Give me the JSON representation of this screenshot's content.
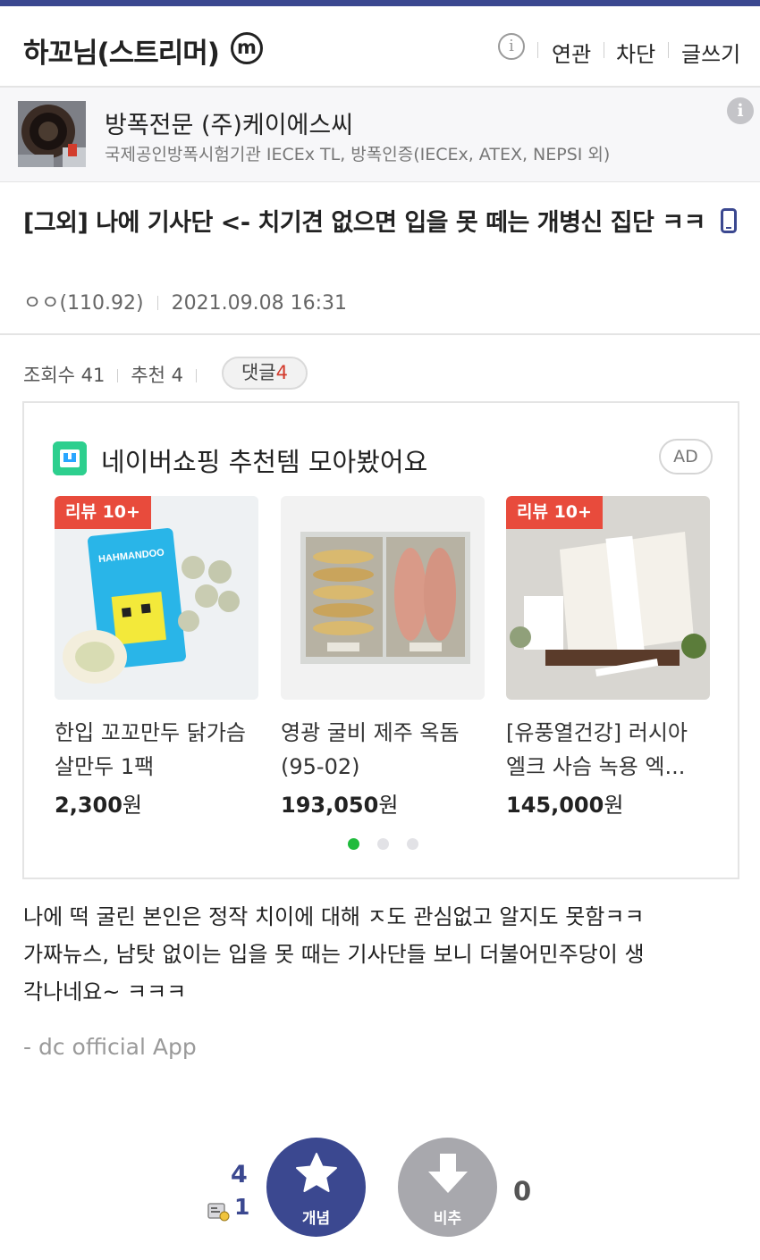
{
  "header": {
    "gallery_title": "하꼬님(스트리머)",
    "minor_badge": "m",
    "info_icon": "info-icon",
    "nav": [
      "연관",
      "차단",
      "글쓰기"
    ]
  },
  "ad_banner": {
    "company": "방폭전문 (주)케이에스씨",
    "description": "국제공인방폭시험기관 IECEx TL, 방폭인증(IECEx, ATEX, NEPSI 외)",
    "info_icon": "info-icon"
  },
  "post": {
    "title": "[그외] 나에 기사단 <- 치기견 없으면 입을 못 떼는 개병신 집단 ㅋㅋ",
    "title_icon": "mobile-phone-icon",
    "author": "ㅇㅇ(110.92)",
    "date": "2021.09.08 16:31",
    "views_label": "조회수 41",
    "recommend_label": "추천 4",
    "comment_label": "댓글",
    "comment_count": "4",
    "body_lines": [
      "나에 떡 굴린 본인은 정작 치이에 대해 ㅈ도 관심없고 알지도 못함ㅋㅋ",
      "가짜뉴스, 남탓 없이는 입을 못 때는 기사단들 보니 더불어민주당이 생",
      "각나네요~ ㅋㅋㅋ"
    ],
    "signature": "- dc official App"
  },
  "shopping": {
    "headline": "네이버쇼핑 추천템 모아봤어요",
    "ad_label": "AD",
    "products": [
      {
        "badge": "리뷰 10+",
        "name": "한입 꼬꼬만두 닭가슴살만두 1팩",
        "price": "2,300",
        "currency": "원",
        "pack_text": "HAHMANDOO"
      },
      {
        "badge": "",
        "name": "영광 굴비 제주 옥돔 (95-02)",
        "price": "193,050",
        "currency": "원"
      },
      {
        "badge": "리뷰 10+",
        "name": "[유풍열건강] 러시아 엘크 사슴 녹용 엑...",
        "price": "145,000",
        "currency": "원"
      }
    ],
    "page_dots": 3,
    "active_dot": 0
  },
  "votes": {
    "recommend_count": "4",
    "fixed_recommend_count": "1",
    "up_label": "개념",
    "down_label": "비추",
    "down_count": "0"
  },
  "colors": {
    "brand": "#3b4890",
    "naver_green": "#2dcf8e",
    "review_badge": "#e84b3c",
    "comment_count": "#d33a2c"
  }
}
